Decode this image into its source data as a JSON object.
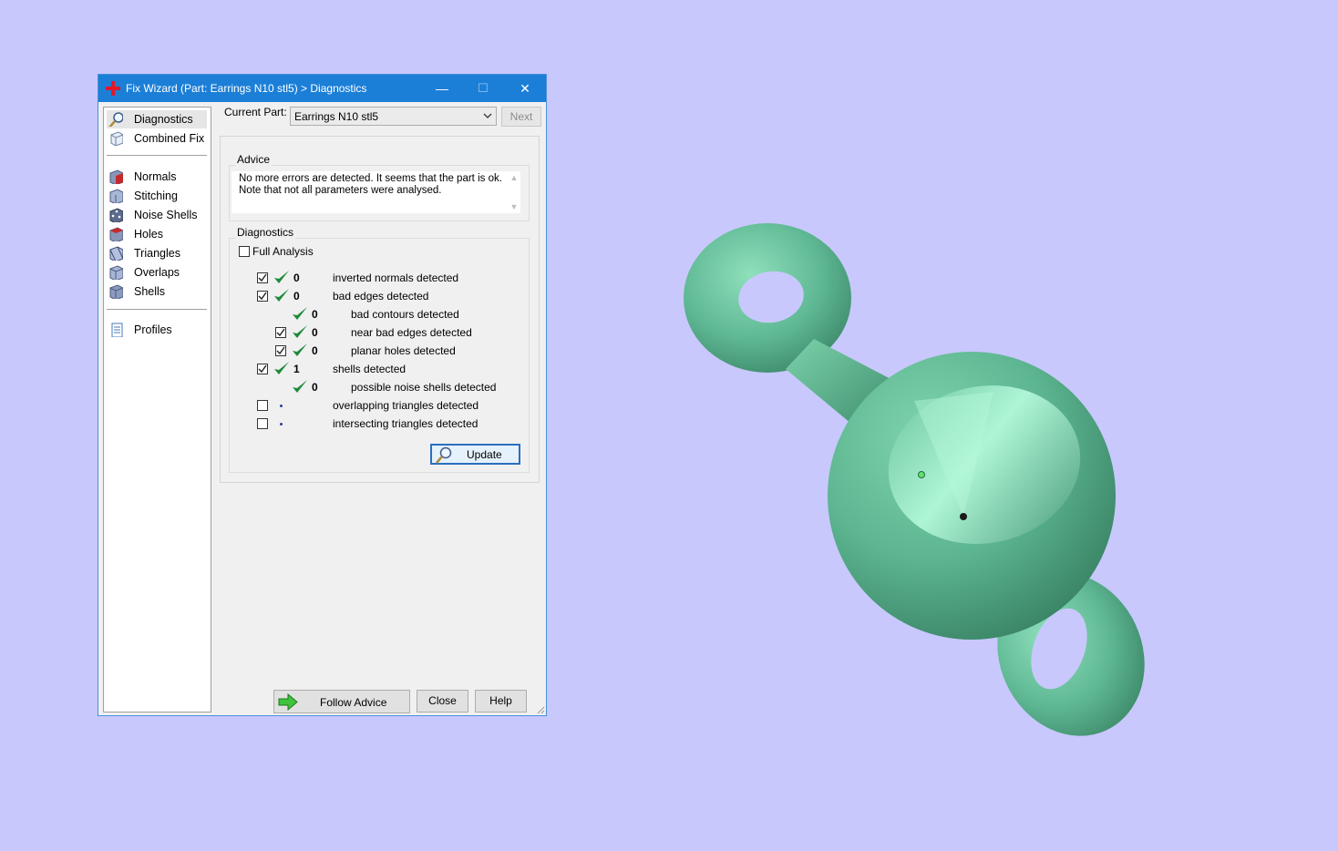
{
  "window": {
    "title": "Fix Wizard (Part: Earrings N10 stl5) > Diagnostics",
    "minimize_symbol": "—",
    "maximize_symbol": "☐",
    "close_symbol": "✕"
  },
  "sidebar": {
    "items": [
      {
        "label": "Diagnostics",
        "icon": "magnifier-icon"
      },
      {
        "label": "Combined Fix",
        "icon": "cube-icon"
      },
      {
        "label": "Normals",
        "icon": "normals-cube-icon"
      },
      {
        "label": "Stitching",
        "icon": "stitching-cube-icon"
      },
      {
        "label": "Noise Shells",
        "icon": "dice-icon"
      },
      {
        "label": "Holes",
        "icon": "holes-cube-icon"
      },
      {
        "label": "Triangles",
        "icon": "triangles-cube-icon"
      },
      {
        "label": "Overlaps",
        "icon": "overlaps-cube-icon"
      },
      {
        "label": "Shells",
        "icon": "shells-cube-icon"
      },
      {
        "label": "Profiles",
        "icon": "document-icon"
      }
    ]
  },
  "current_part": {
    "label": "Current Part:",
    "value": "Earrings N10 stl5",
    "next_label": "Next"
  },
  "advice": {
    "title": "Advice",
    "line1": "No more errors are detected. It seems that the part is ok.",
    "line2": "Note that not all parameters were analysed."
  },
  "diagnostics": {
    "title": "Diagnostics",
    "full_analysis_label": "Full Analysis",
    "full_analysis_checked": false,
    "rows": [
      {
        "checked": true,
        "count": "0",
        "text": "inverted normals detected"
      },
      {
        "checked": true,
        "count": "0",
        "text": "bad edges detected"
      },
      {
        "count": "0",
        "text": "bad contours detected"
      },
      {
        "checked": true,
        "count": "0",
        "text": "near bad edges detected"
      },
      {
        "checked": true,
        "count": "0",
        "text": "planar holes detected"
      },
      {
        "checked": true,
        "count": "1",
        "text": "shells detected"
      },
      {
        "count": "0",
        "text": "possible noise shells detected"
      },
      {
        "checked": false,
        "text": "overlapping triangles detected"
      },
      {
        "checked": false,
        "text": "intersecting triangles detected"
      }
    ],
    "update_label": "Update"
  },
  "buttons": {
    "follow_advice": "Follow Advice",
    "close": "Close",
    "help": "Help"
  },
  "colors": {
    "background": "#c8c8fc",
    "titlebar": "#1c7fd7",
    "model": "#5fb894",
    "check": "#1e8a3a"
  }
}
